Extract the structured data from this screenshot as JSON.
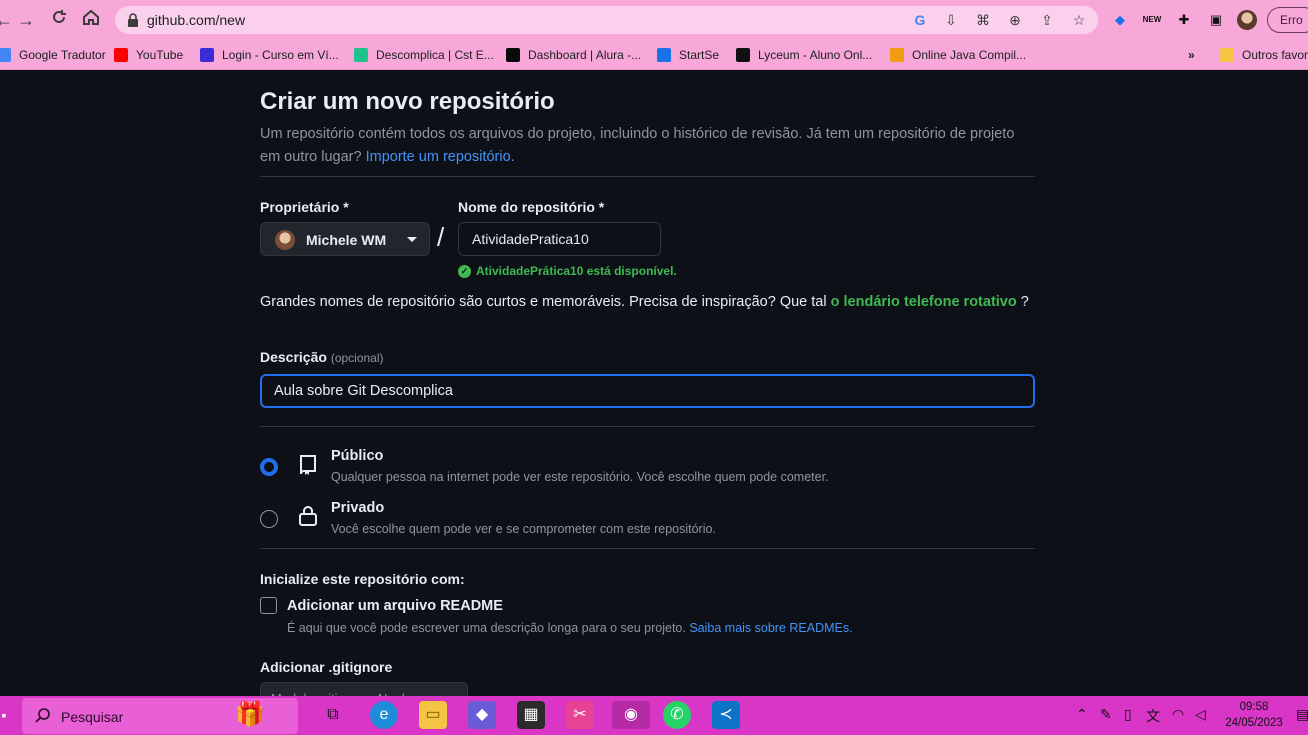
{
  "browser": {
    "url": "github.com/new",
    "error_label": "Erro",
    "bookmarks": [
      {
        "label": "Google Tradutor",
        "color": "#4285f4"
      },
      {
        "label": "YouTube",
        "color": "#ff0000"
      },
      {
        "label": "Login - Curso em Ví...",
        "color": "#3b2bd6"
      },
      {
        "label": "Descomplica | Cst E...",
        "color": "#1ec28b"
      },
      {
        "label": "Dashboard | Alura -...",
        "color": "#0a0a0a"
      },
      {
        "label": "StartSe",
        "color": "#1a73e8"
      },
      {
        "label": "Lyceum - Aluno Onl...",
        "color": "#111111"
      },
      {
        "label": "Online Java Compil...",
        "color": "#f39c12"
      }
    ],
    "other_bookmarks": "Outros favor"
  },
  "form": {
    "title": "Criar um novo repositório",
    "subtitle": "Um repositório contém todos os arquivos do projeto, incluindo o histórico de revisão. Já tem um repositório de projeto em outro lugar?",
    "import_link": "Importe um repositório.",
    "owner_label": "Proprietário *",
    "owner_value": "Michele WM",
    "slash": "/",
    "repo_label": "Nome do repositório *",
    "repo_value": "AtividadePratica10",
    "available_msg": "AtividadePrática10 está disponível.",
    "hint_text": "Grandes nomes de repositório são curtos e memoráveis. Precisa de inspiração? Que tal",
    "hint_suggestion": "o lendário telefone rotativo",
    "hint_end": "?",
    "description_label": "Descrição",
    "description_optional": "(opcional)",
    "description_value": "Aula sobre Git Descomplica",
    "visibility": {
      "public_title": "Público",
      "public_desc": "Qualquer pessoa na internet pode ver este repositório. Você escolhe quem pode cometer.",
      "private_title": "Privado",
      "private_desc": "Você escolhe quem pode ver e se comprometer com este repositório.",
      "selected": "public"
    },
    "init_label": "Inicialize este repositório com:",
    "readme_label": "Adicionar um arquivo README",
    "readme_desc": "É aqui que você pode escrever uma descrição longa para o seu projeto.",
    "readme_link": "Saiba mais sobre READMEs.",
    "gitignore_label": "Adicionar .gitignore",
    "gitignore_value": "Modelo .gitignore: Nenhum"
  },
  "taskbar": {
    "search_placeholder": "Pesquisar",
    "time": "09:58",
    "date": "24/05/2023"
  },
  "colors": {
    "page_bg": "#0d1117",
    "chrome_bg": "#f7a8d8",
    "taskbar_bg": "#d935c7",
    "accent_blue": "#1f6feb",
    "success_green": "#3fb950"
  }
}
